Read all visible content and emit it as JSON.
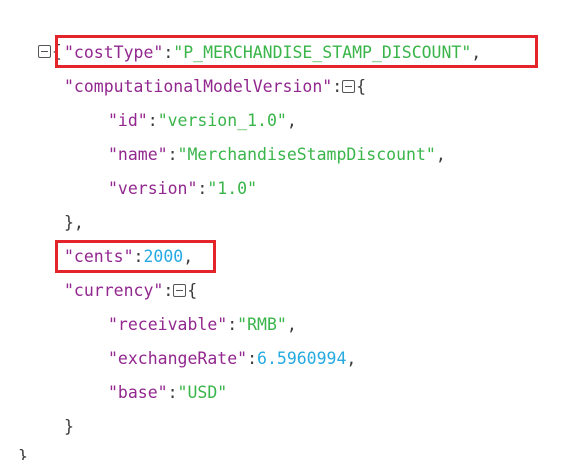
{
  "json_viewer": {
    "open_brace": "{",
    "close_brace": "}",
    "colon": ":",
    "comma": ",",
    "lines": {
      "cost_type": {
        "key": "\"costType\"",
        "value": "\"P_MERCHANDISE_STAMP_DISCOUNT\""
      },
      "model_version": {
        "key": "\"computationalModelVersion\""
      },
      "model_id": {
        "key": "\"id\"",
        "value": "\"version_1.0\""
      },
      "model_name": {
        "key": "\"name\"",
        "value": "\"MerchandiseStampDiscount\""
      },
      "model_ver": {
        "key": "\"version\"",
        "value": "\"1.0\""
      },
      "model_close": {
        "text": "},"
      },
      "cents": {
        "key": "\"cents\"",
        "value": "2000"
      },
      "currency": {
        "key": "\"currency\""
      },
      "receivable": {
        "key": "\"receivable\"",
        "value": "\"RMB\""
      },
      "exchange_rate": {
        "key": "\"exchangeRate\"",
        "value": "6.5960994"
      },
      "base": {
        "key": "\"base\"",
        "value": "\"USD\""
      },
      "currency_close": {
        "text": "}"
      },
      "root_close": {
        "text": "}"
      }
    }
  },
  "colors": {
    "key": "#92278f",
    "string": "#3ab54a",
    "number": "#25aae2",
    "highlight": "#e3242b"
  },
  "icons": {
    "collapse": "collapse-toggle-icon"
  }
}
